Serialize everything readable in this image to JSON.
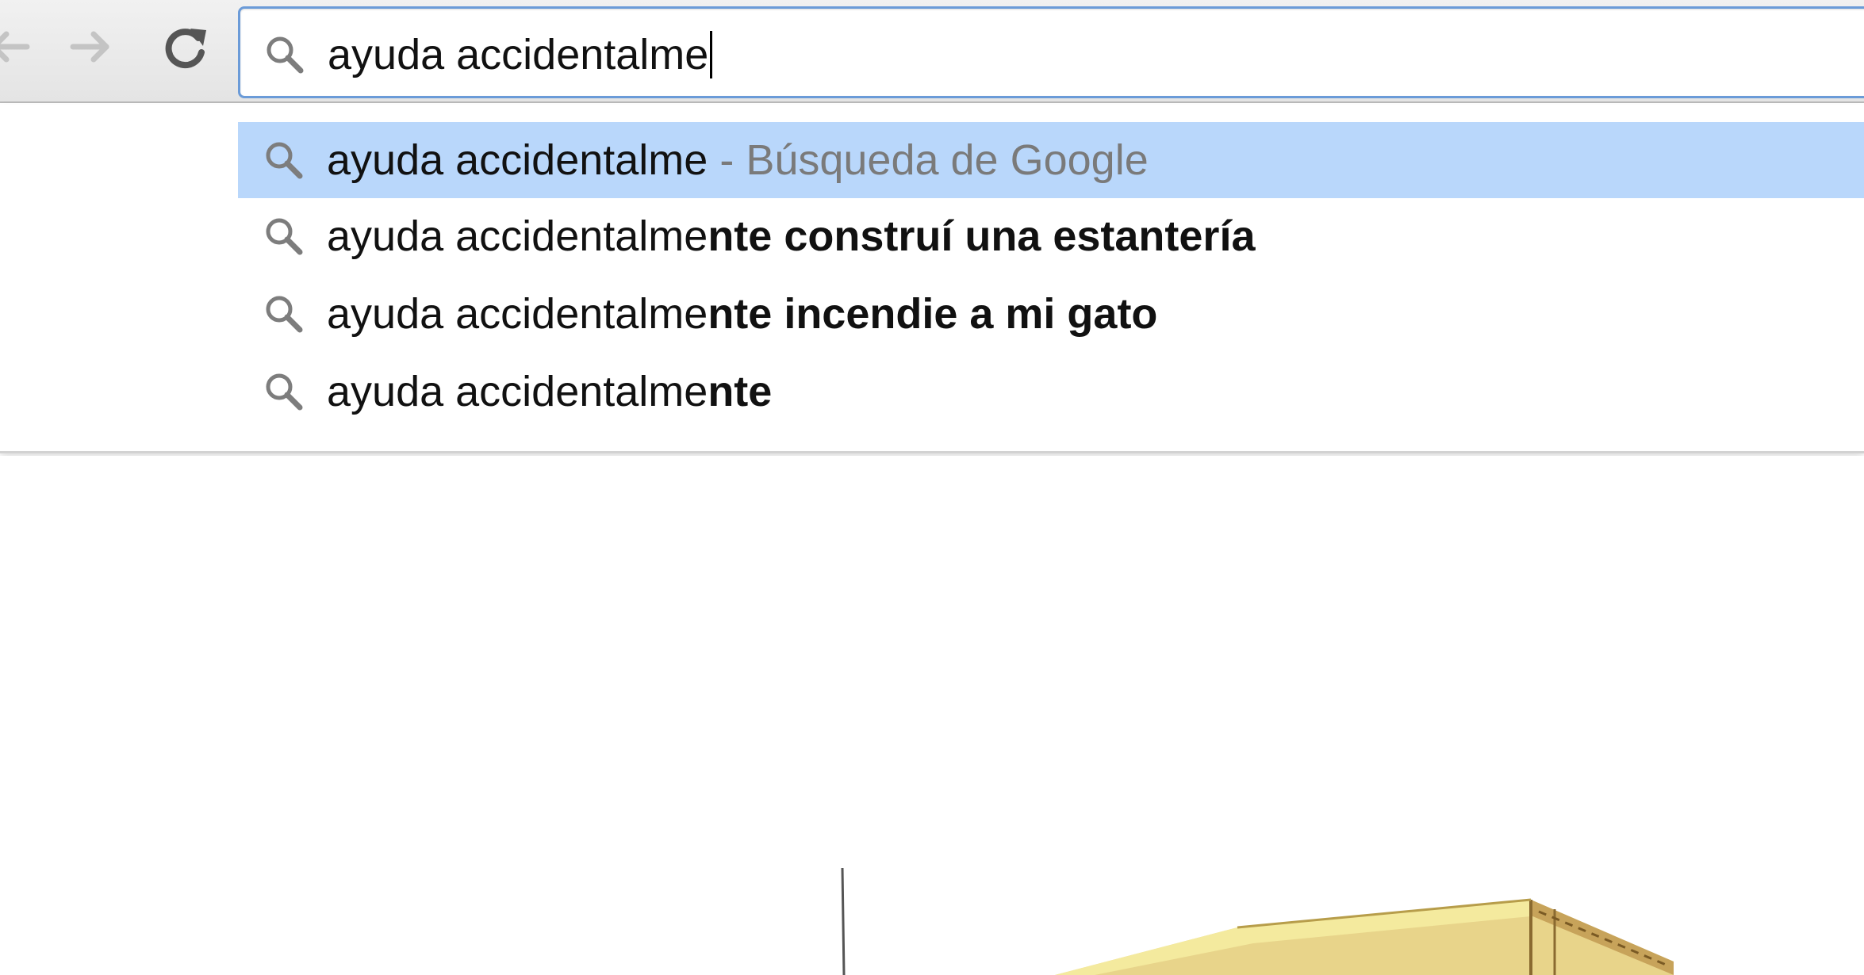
{
  "browser": {
    "nav": {
      "back_icon": "arrow-left-icon",
      "forward_icon": "arrow-right-icon",
      "reload_icon": "reload-icon"
    },
    "omnibox": {
      "icon": "search-icon",
      "value": "ayuda accidentalme"
    }
  },
  "suggestions": [
    {
      "typed": "ayuda accidentalme",
      "completion": "",
      "hint": "- Búsqueda de Google",
      "selected": true
    },
    {
      "typed": "ayuda accidentalme",
      "completion": "nte construí una estantería",
      "hint": "",
      "selected": false
    },
    {
      "typed": "ayuda accidentalme",
      "completion": "nte incendie a mi gato",
      "hint": "",
      "selected": false
    },
    {
      "typed": "ayuda accidentalme",
      "completion": "nte",
      "hint": "",
      "selected": false
    }
  ],
  "colors": {
    "selected_row": "#b9d7fb",
    "omnibox_border": "#6b9bd8",
    "hint_text": "#7a7a7a"
  }
}
